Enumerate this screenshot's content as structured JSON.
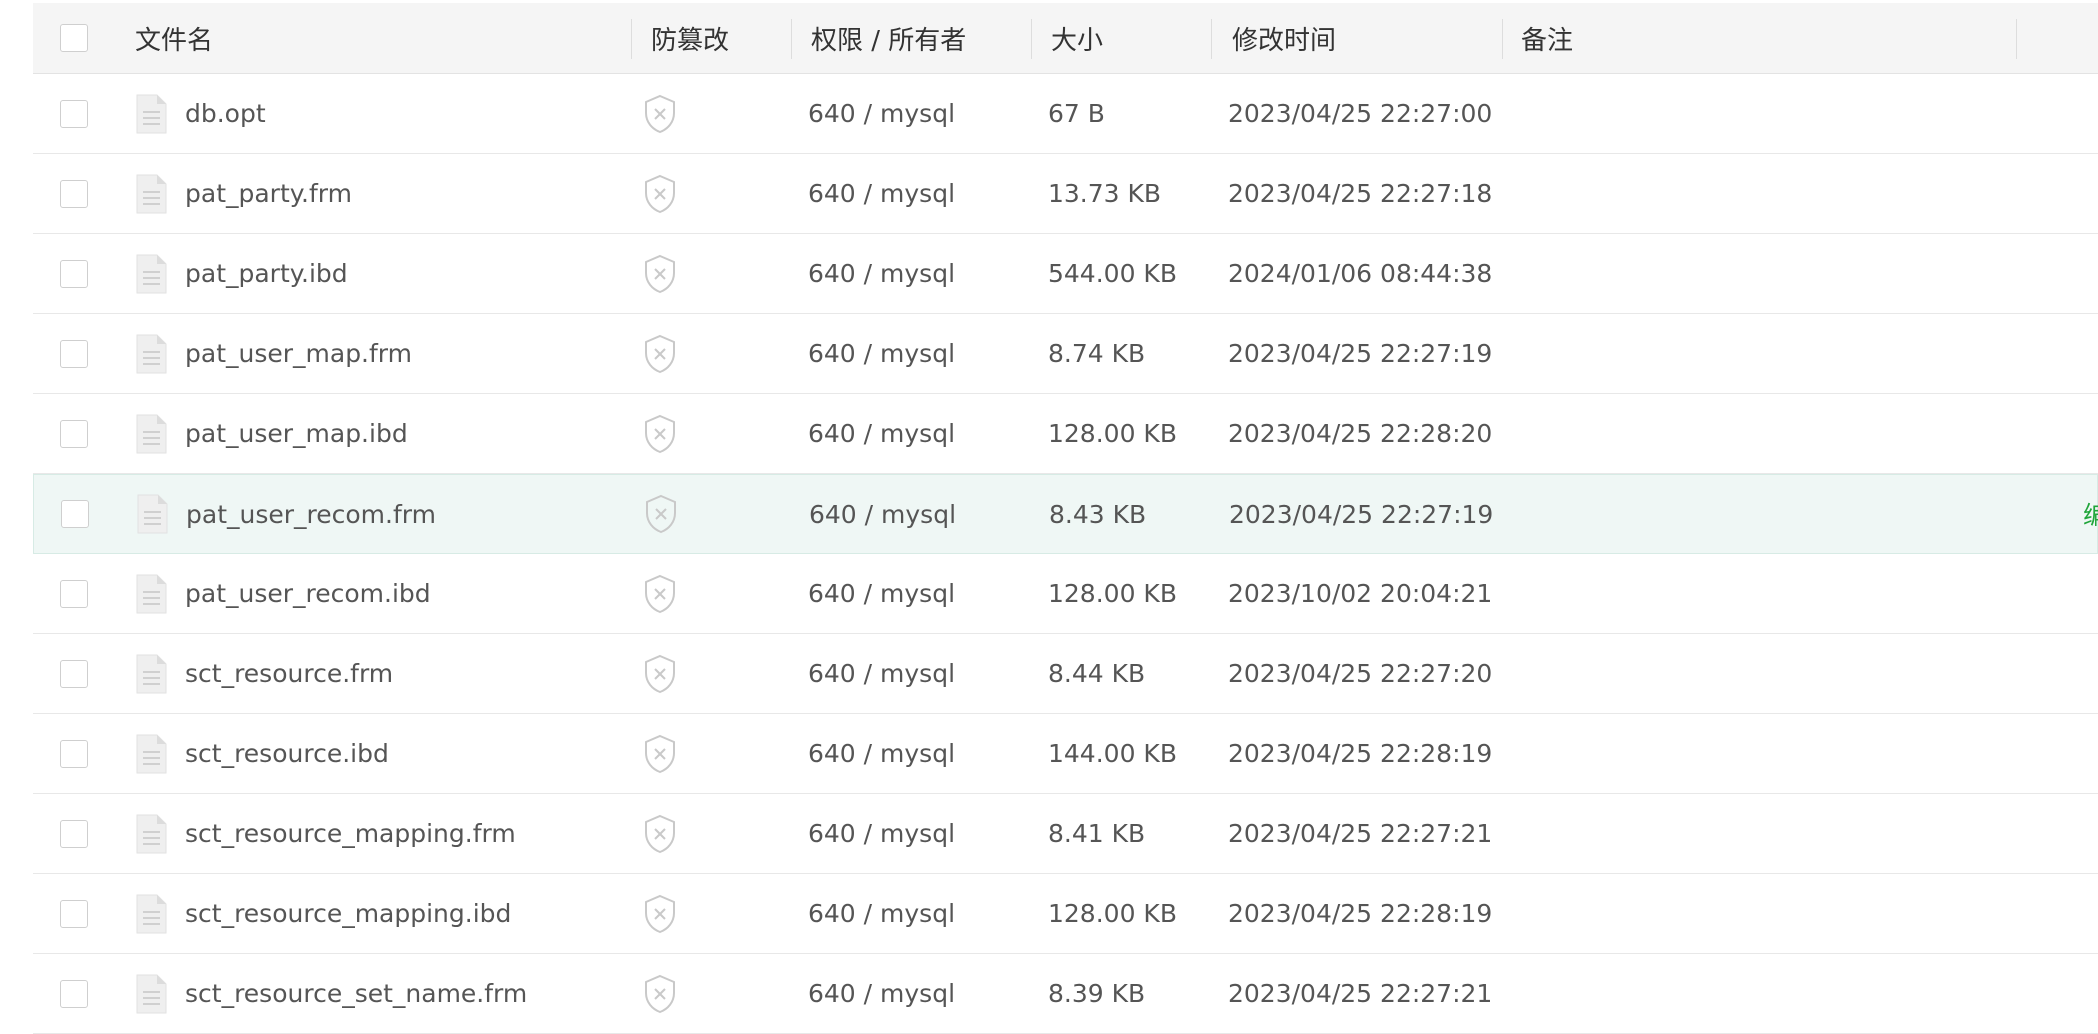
{
  "header": {
    "filename": "文件名",
    "protect": "防篡改",
    "permission": "权限 / 所有者",
    "size": "大小",
    "modified": "修改时间",
    "note": "备注"
  },
  "rows": [
    {
      "name": "db.opt",
      "perm": "640 / mysql",
      "size": "67 B",
      "time": "2023/04/25 22:27:00"
    },
    {
      "name": "pat_party.frm",
      "perm": "640 / mysql",
      "size": "13.73 KB",
      "time": "2023/04/25 22:27:18"
    },
    {
      "name": "pat_party.ibd",
      "perm": "640 / mysql",
      "size": "544.00 KB",
      "time": "2024/01/06 08:44:38"
    },
    {
      "name": "pat_user_map.frm",
      "perm": "640 / mysql",
      "size": "8.74 KB",
      "time": "2023/04/25 22:27:19"
    },
    {
      "name": "pat_user_map.ibd",
      "perm": "640 / mysql",
      "size": "128.00 KB",
      "time": "2023/04/25 22:28:20"
    },
    {
      "name": "pat_user_recom.frm",
      "perm": "640 / mysql",
      "size": "8.43 KB",
      "time": "2023/04/25 22:27:19",
      "op": "编"
    },
    {
      "name": "pat_user_recom.ibd",
      "perm": "640 / mysql",
      "size": "128.00 KB",
      "time": "2023/10/02 20:04:21"
    },
    {
      "name": "sct_resource.frm",
      "perm": "640 / mysql",
      "size": "8.44 KB",
      "time": "2023/04/25 22:27:20"
    },
    {
      "name": "sct_resource.ibd",
      "perm": "640 / mysql",
      "size": "144.00 KB",
      "time": "2023/04/25 22:28:19"
    },
    {
      "name": "sct_resource_mapping.frm",
      "perm": "640 / mysql",
      "size": "8.41 KB",
      "time": "2023/04/25 22:27:21"
    },
    {
      "name": "sct_resource_mapping.ibd",
      "perm": "640 / mysql",
      "size": "128.00 KB",
      "time": "2023/04/25 22:28:19"
    },
    {
      "name": "sct_resource_set_name.frm",
      "perm": "640 / mysql",
      "size": "8.39 KB",
      "time": "2023/04/25 22:27:21"
    }
  ],
  "selected_row": 5,
  "icons": {
    "file": "file-icon",
    "protect": "shield-x-icon"
  },
  "colors": {
    "accent": "#20a53a",
    "selected_row_bg": "#eff7f5"
  }
}
